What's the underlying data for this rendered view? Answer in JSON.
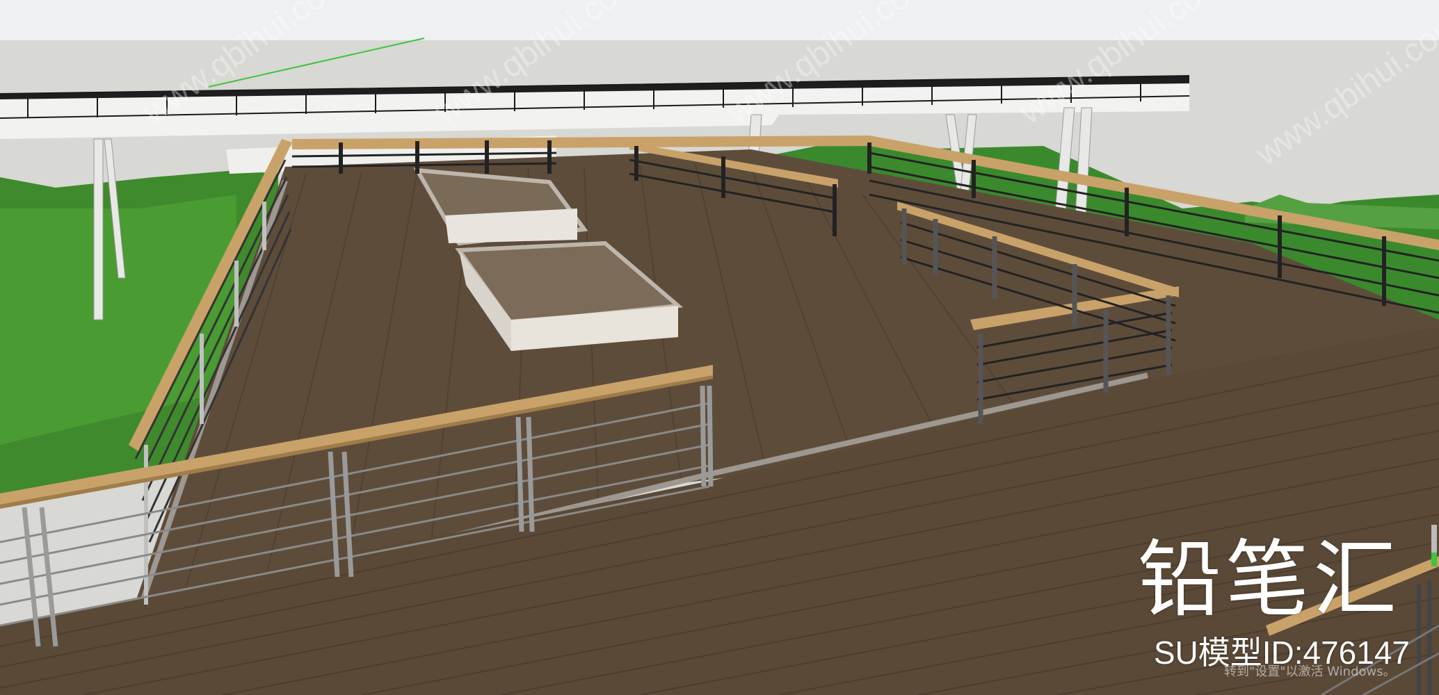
{
  "scene": {
    "subject": "wooden observation deck with railings",
    "colors": {
      "sky": "#d8d8d4",
      "deck": "#5c4b3a",
      "deck_light": "#6b5846",
      "grass": "#3f8a2c",
      "rail_wood": "#c9a26a",
      "rail_metal": "#2a2a2a",
      "concrete": "#e6e2db"
    }
  },
  "brand": "铅笔汇",
  "model_id": "SU模型ID:476147",
  "watermark": "www.qbihui.com",
  "os_overlay": "转到\"设置\"以激活 Windows。"
}
